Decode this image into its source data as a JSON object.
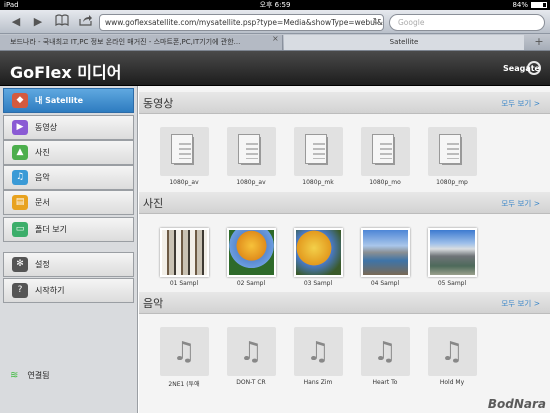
{
  "status_bar": {
    "device": "iPad",
    "time": "오후 6:59",
    "battery": "84%"
  },
  "browser": {
    "url": "www.goflexsatellite.com/mysatellite.psp?type=Media&showType=webui&",
    "search_placeholder": "Google",
    "tabs": [
      {
        "label": "보드나라 - 국내최고 IT,PC 정보 온라인 매거진 - 스마트폰,PC,IT기기에 관한..."
      },
      {
        "label": "Satellite"
      }
    ],
    "new_tab": "+",
    "close_tab": "×"
  },
  "app": {
    "title": "GoFlex 미디어",
    "brand": "Seagate"
  },
  "sidebar": {
    "items": [
      {
        "label": "내 Satellite",
        "icon": "satellite-icon",
        "color": "#d45a3e"
      },
      {
        "label": "동영상",
        "icon": "movie-icon",
        "color": "#8a5ad4"
      },
      {
        "label": "사진",
        "icon": "photo-icon",
        "color": "#4cae4c"
      },
      {
        "label": "음악",
        "icon": "music-icon",
        "color": "#3a9ad6"
      },
      {
        "label": "문서",
        "icon": "document-icon",
        "color": "#e8a21e"
      },
      {
        "label": "폴더 보기",
        "icon": "folder-icon",
        "color": "#3cae6a"
      },
      {
        "label": "설정",
        "icon": "gear-icon",
        "color": "#555555"
      },
      {
        "label": "시작하기",
        "icon": "help-icon",
        "color": "#555555"
      }
    ],
    "connection": "연결됨"
  },
  "sections": [
    {
      "title": "동영상",
      "more": "모두 보기 >",
      "items": [
        "1080p_av",
        "1080p_av",
        "1080p_mk",
        "1080p_mo",
        "1080p_mp"
      ]
    },
    {
      "title": "사진",
      "more": "모두 보기 >",
      "items": [
        "01 Sampl",
        "02 Sampl",
        "03 Sampl",
        "04 Sampl",
        "05 Sampl"
      ]
    },
    {
      "title": "음악",
      "more": "모두 보기 >",
      "items": [
        "2NE1 (투애",
        "DON-T CR",
        "Hans Zim",
        "Heart To",
        "Hold My"
      ]
    }
  ],
  "watermark": "BodNara",
  "colors": {
    "accent": "#2e7cc0",
    "link": "#3a86c8"
  }
}
